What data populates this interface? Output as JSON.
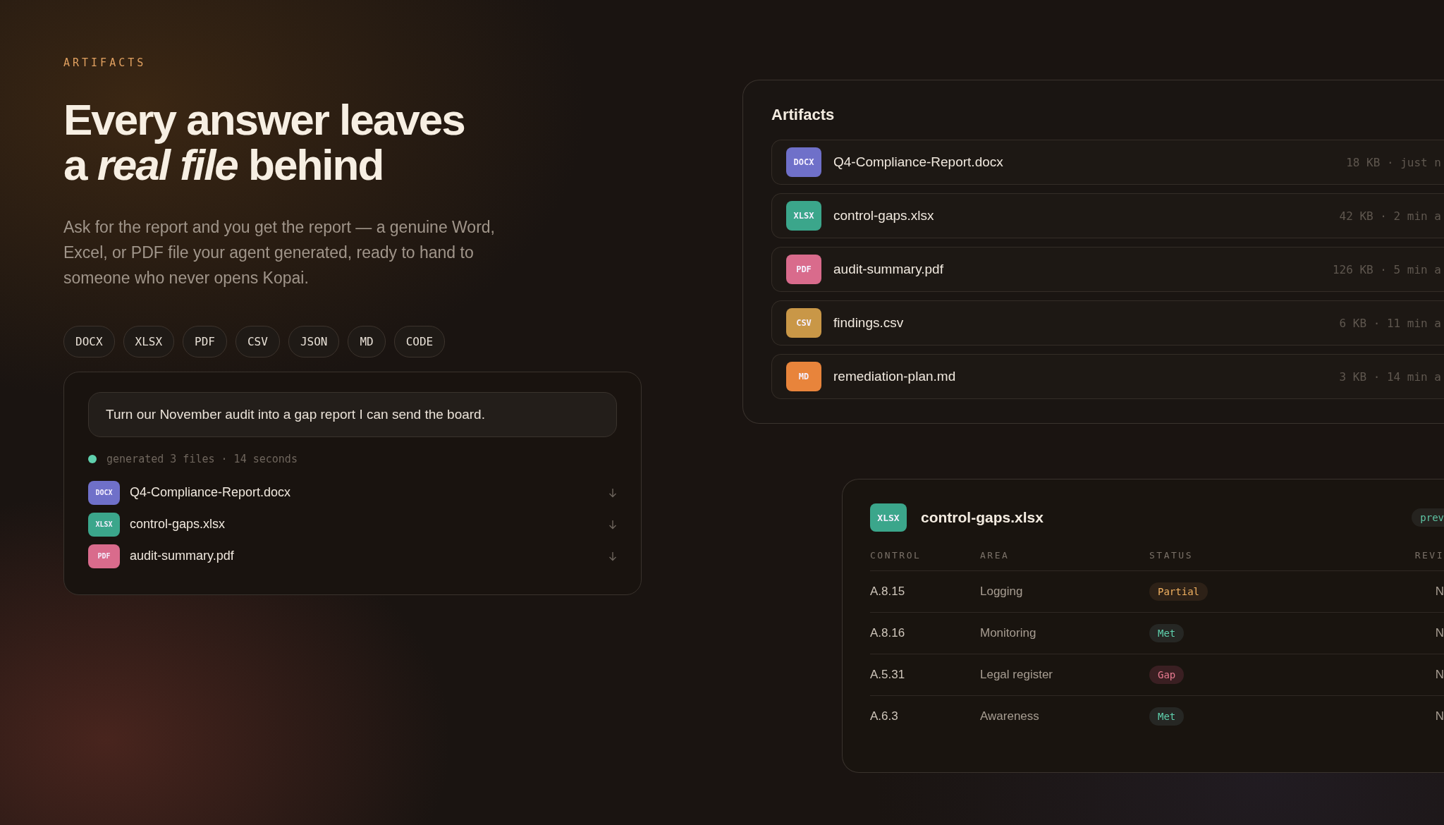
{
  "eyebrow": "ARTIFACTS",
  "headline": [
    "Every answer leaves",
    "a *real file* behind"
  ],
  "intro": "Ask for the report and you get the report — a genuine Word, Excel, or PDF file your agent generated, ready to hand to someone who never opens Kopai.",
  "formats": [
    "DOCX",
    "XLSX",
    "PDF",
    "CSV",
    "JSON",
    "MD",
    "CODE"
  ],
  "prompt_card": {
    "prompt": "Turn our November audit into a gap report I can send the board.",
    "status": "generated 3 files · 14 seconds",
    "files": [
      {
        "badge": "DOCX",
        "color": "#6f70c9",
        "name": "Q4-Compliance-Report.docx"
      },
      {
        "badge": "XLSX",
        "color": "#3ba68b",
        "name": "control-gaps.xlsx"
      },
      {
        "badge": "PDF",
        "color": "#d96b8c",
        "name": "audit-summary.pdf"
      }
    ]
  },
  "artifacts_panel": {
    "title": "Artifacts",
    "files": [
      {
        "badge": "DOCX",
        "color": "#6f70c9",
        "name": "Q4-Compliance-Report.docx",
        "meta": "18 KB · just n"
      },
      {
        "badge": "XLSX",
        "color": "#3ba68b",
        "name": "control-gaps.xlsx",
        "meta": "42 KB · 2 min a"
      },
      {
        "badge": "PDF",
        "color": "#d96b8c",
        "name": "audit-summary.pdf",
        "meta": "126 KB · 5 min a"
      },
      {
        "badge": "CSV",
        "color": "#c99747",
        "name": "findings.csv",
        "meta": "6 KB · 11 min a"
      },
      {
        "badge": "MD",
        "color": "#e8843b",
        "name": "remediation-plan.md",
        "meta": "3 KB · 14 min a"
      }
    ]
  },
  "preview_card": {
    "badge": "XLSX",
    "color": "#3ba68b",
    "title": "control-gaps.xlsx",
    "tag": "prev",
    "columns": [
      "CONTROL",
      "AREA",
      "STATUS",
      "REVI"
    ],
    "rows": [
      {
        "control": "A.8.15",
        "area": "Logging",
        "status": "Partial",
        "kind": "partial",
        "column_4": "N"
      },
      {
        "control": "A.8.16",
        "area": "Monitoring",
        "status": "Met",
        "kind": "met",
        "column_4": "N"
      },
      {
        "control": "A.5.31",
        "area": "Legal register",
        "status": "Gap",
        "kind": "gap",
        "column_4": "N"
      },
      {
        "control": "A.6.3",
        "area": "Awareness",
        "status": "Met",
        "kind": "met",
        "column_4": "N"
      }
    ]
  }
}
